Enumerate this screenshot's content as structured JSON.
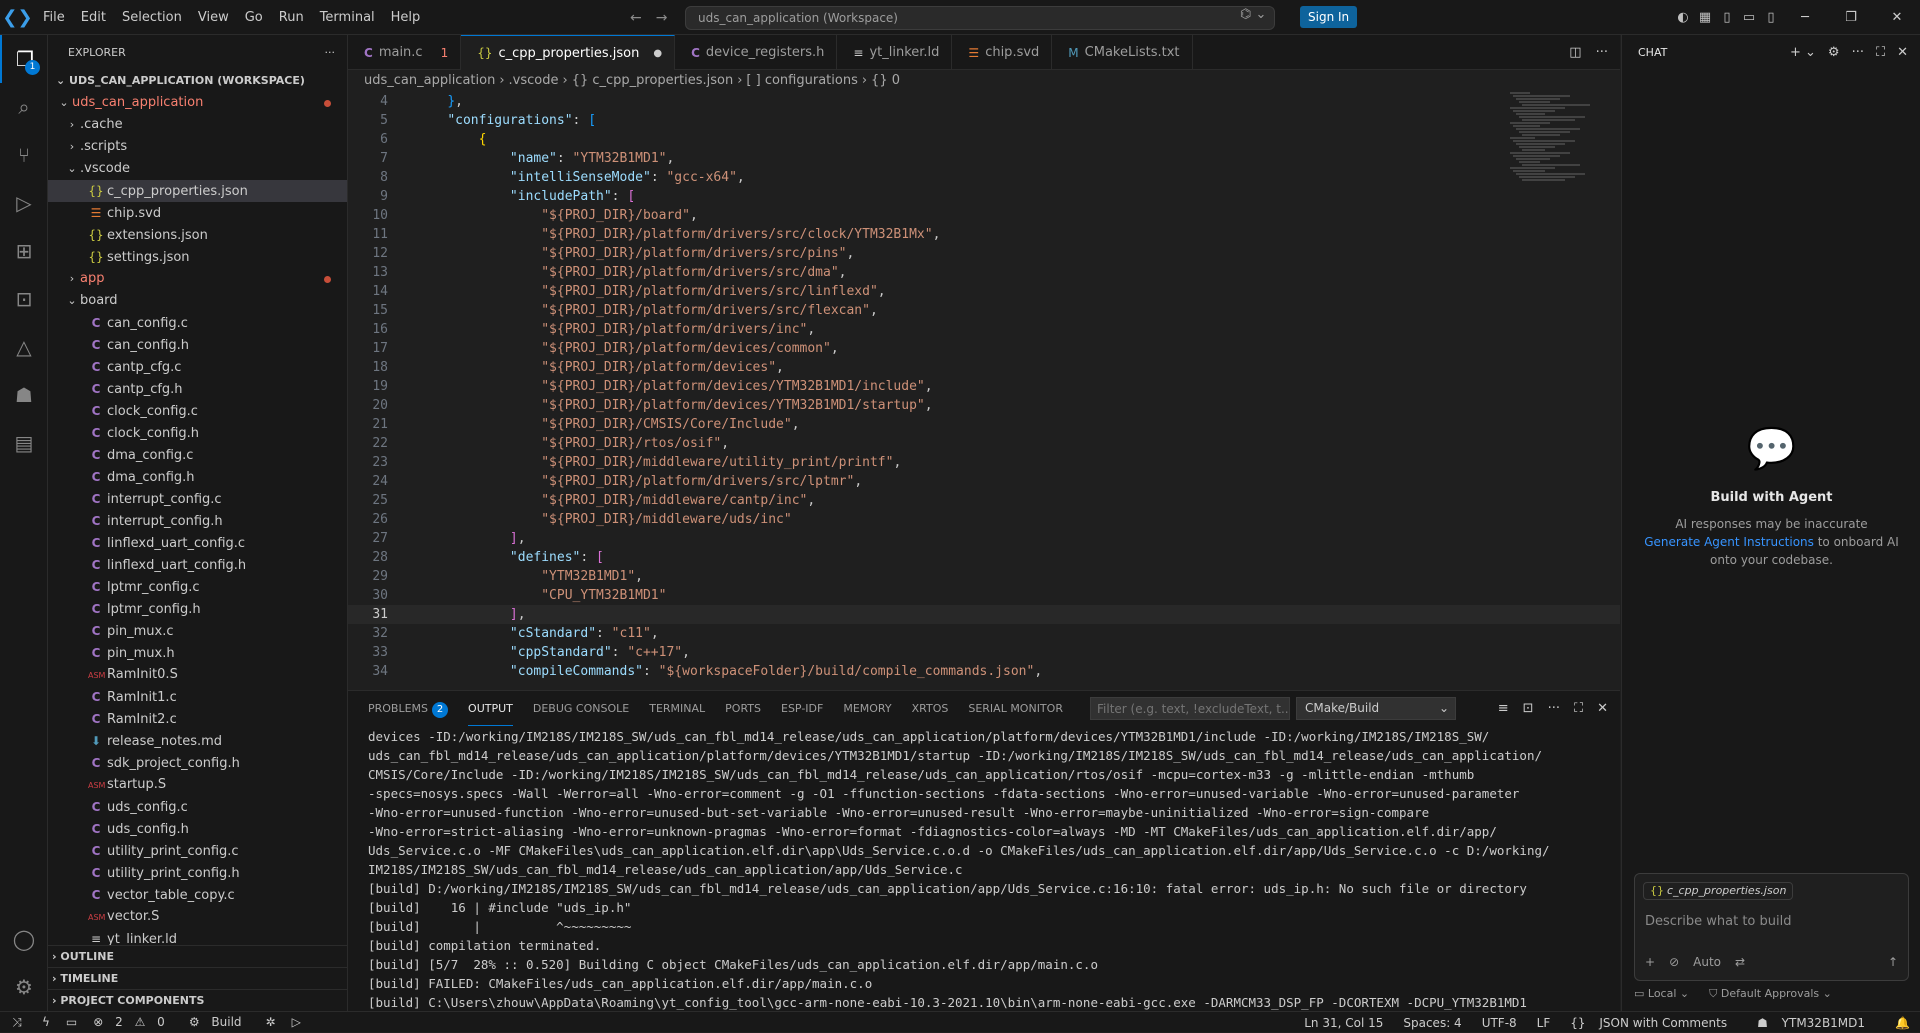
{
  "titlebar": {
    "menu": [
      "File",
      "Edit",
      "Selection",
      "View",
      "Go",
      "Run",
      "Terminal",
      "Help"
    ],
    "command_center": "uds_can_application (Workspace)",
    "signin_label": "Sign In"
  },
  "explorer": {
    "header": "EXPLORER",
    "workspace_title": "UDS_CAN_APPLICATION (WORKSPACE)",
    "items": [
      {
        "label": "uds_can_application",
        "indent": 0,
        "chev": "v",
        "icon": "",
        "cls": "red",
        "dot": true
      },
      {
        "label": ".cache",
        "indent": 1,
        "chev": ">",
        "icon": "",
        "cls": "",
        "dot": false
      },
      {
        "label": ".scripts",
        "indent": 1,
        "chev": ">",
        "icon": "",
        "cls": "",
        "dot": false
      },
      {
        "label": ".vscode",
        "indent": 1,
        "chev": "v",
        "icon": "",
        "cls": "",
        "dot": false
      },
      {
        "label": "c_cpp_properties.json",
        "indent": 2,
        "chev": "",
        "icon": "json",
        "cls": "",
        "dot": false,
        "selected": true
      },
      {
        "label": "chip.svd",
        "indent": 2,
        "chev": "",
        "icon": "svd",
        "cls": "",
        "dot": false
      },
      {
        "label": "extensions.json",
        "indent": 2,
        "chev": "",
        "icon": "json",
        "cls": "",
        "dot": false
      },
      {
        "label": "settings.json",
        "indent": 2,
        "chev": "",
        "icon": "json",
        "cls": "",
        "dot": false
      },
      {
        "label": "app",
        "indent": 1,
        "chev": ">",
        "icon": "",
        "cls": "red",
        "dot": true
      },
      {
        "label": "board",
        "indent": 1,
        "chev": "v",
        "icon": "",
        "cls": "",
        "dot": false
      },
      {
        "label": "can_config.c",
        "indent": 2,
        "chev": "",
        "icon": "c",
        "cls": "",
        "dot": false
      },
      {
        "label": "can_config.h",
        "indent": 2,
        "chev": "",
        "icon": "h",
        "cls": "",
        "dot": false
      },
      {
        "label": "cantp_cfg.c",
        "indent": 2,
        "chev": "",
        "icon": "c",
        "cls": "",
        "dot": false
      },
      {
        "label": "cantp_cfg.h",
        "indent": 2,
        "chev": "",
        "icon": "h",
        "cls": "",
        "dot": false
      },
      {
        "label": "clock_config.c",
        "indent": 2,
        "chev": "",
        "icon": "c",
        "cls": "",
        "dot": false
      },
      {
        "label": "clock_config.h",
        "indent": 2,
        "chev": "",
        "icon": "h",
        "cls": "",
        "dot": false
      },
      {
        "label": "dma_config.c",
        "indent": 2,
        "chev": "",
        "icon": "c",
        "cls": "",
        "dot": false
      },
      {
        "label": "dma_config.h",
        "indent": 2,
        "chev": "",
        "icon": "h",
        "cls": "",
        "dot": false
      },
      {
        "label": "interrupt_config.c",
        "indent": 2,
        "chev": "",
        "icon": "c",
        "cls": "",
        "dot": false
      },
      {
        "label": "interrupt_config.h",
        "indent": 2,
        "chev": "",
        "icon": "h",
        "cls": "",
        "dot": false
      },
      {
        "label": "linflexd_uart_config.c",
        "indent": 2,
        "chev": "",
        "icon": "c",
        "cls": "",
        "dot": false
      },
      {
        "label": "linflexd_uart_config.h",
        "indent": 2,
        "chev": "",
        "icon": "h",
        "cls": "",
        "dot": false
      },
      {
        "label": "lptmr_config.c",
        "indent": 2,
        "chev": "",
        "icon": "c",
        "cls": "",
        "dot": false
      },
      {
        "label": "lptmr_config.h",
        "indent": 2,
        "chev": "",
        "icon": "h",
        "cls": "",
        "dot": false
      },
      {
        "label": "pin_mux.c",
        "indent": 2,
        "chev": "",
        "icon": "c",
        "cls": "",
        "dot": false
      },
      {
        "label": "pin_mux.h",
        "indent": 2,
        "chev": "",
        "icon": "h",
        "cls": "",
        "dot": false
      },
      {
        "label": "RamInit0.S",
        "indent": 2,
        "chev": "",
        "icon": "asm",
        "cls": "",
        "dot": false
      },
      {
        "label": "RamInit1.c",
        "indent": 2,
        "chev": "",
        "icon": "c",
        "cls": "",
        "dot": false
      },
      {
        "label": "RamInit2.c",
        "indent": 2,
        "chev": "",
        "icon": "c",
        "cls": "",
        "dot": false
      },
      {
        "label": "release_notes.md",
        "indent": 2,
        "chev": "",
        "icon": "md",
        "cls": "",
        "dot": false
      },
      {
        "label": "sdk_project_config.h",
        "indent": 2,
        "chev": "",
        "icon": "h",
        "cls": "",
        "dot": false
      },
      {
        "label": "startup.S",
        "indent": 2,
        "chev": "",
        "icon": "asm",
        "cls": "",
        "dot": false
      },
      {
        "label": "uds_config.c",
        "indent": 2,
        "chev": "",
        "icon": "c",
        "cls": "",
        "dot": false
      },
      {
        "label": "uds_config.h",
        "indent": 2,
        "chev": "",
        "icon": "h",
        "cls": "",
        "dot": false
      },
      {
        "label": "utility_print_config.c",
        "indent": 2,
        "chev": "",
        "icon": "c",
        "cls": "",
        "dot": false
      },
      {
        "label": "utility_print_config.h",
        "indent": 2,
        "chev": "",
        "icon": "h",
        "cls": "",
        "dot": false
      },
      {
        "label": "vector_table_copy.c",
        "indent": 2,
        "chev": "",
        "icon": "c",
        "cls": "",
        "dot": false
      },
      {
        "label": "vector.S",
        "indent": 2,
        "chev": "",
        "icon": "asm",
        "cls": "",
        "dot": false
      },
      {
        "label": "yt_linker.ld",
        "indent": 2,
        "chev": "",
        "icon": "ld",
        "cls": "",
        "dot": false
      }
    ],
    "sections": [
      "OUTLINE",
      "TIMELINE",
      "PROJECT COMPONENTS"
    ]
  },
  "tabs": [
    {
      "label": "main.c",
      "icon": "c",
      "extra": "1",
      "active": false
    },
    {
      "label": "c_cpp_properties.json",
      "icon": "json",
      "extra": "dot",
      "active": true
    },
    {
      "label": "device_registers.h",
      "icon": "h",
      "extra": "",
      "active": false
    },
    {
      "label": "yt_linker.ld",
      "icon": "ld",
      "extra": "",
      "active": false
    },
    {
      "label": "chip.svd",
      "icon": "svd",
      "extra": "",
      "active": false
    },
    {
      "label": "CMakeLists.txt",
      "icon": "cmake",
      "extra": "",
      "active": false
    }
  ],
  "breadcrumb": [
    "uds_can_application",
    ".vscode",
    "{} c_cpp_properties.json",
    "[ ] configurations",
    "{} 0"
  ],
  "code": {
    "current_line": 31,
    "lines": [
      {
        "n": 4,
        "t": [
          [
            "p",
            "    "
          ],
          [
            "b2",
            "}"
          ],
          [
            "p",
            ","
          ]
        ]
      },
      {
        "n": 5,
        "t": [
          [
            "p",
            "    "
          ],
          [
            "k",
            "\"configurations\""
          ],
          [
            "p",
            ": "
          ],
          [
            "b2",
            "["
          ]
        ]
      },
      {
        "n": 6,
        "t": [
          [
            "p",
            "        "
          ],
          [
            "b3",
            "{"
          ]
        ]
      },
      {
        "n": 7,
        "t": [
          [
            "p",
            "            "
          ],
          [
            "k",
            "\"name\""
          ],
          [
            "p",
            ": "
          ],
          [
            "s",
            "\"YTM32B1MD1\""
          ],
          [
            "p",
            ","
          ]
        ]
      },
      {
        "n": 8,
        "t": [
          [
            "p",
            "            "
          ],
          [
            "k",
            "\"intelliSenseMode\""
          ],
          [
            "p",
            ": "
          ],
          [
            "s",
            "\"gcc-x64\""
          ],
          [
            "p",
            ","
          ]
        ]
      },
      {
        "n": 9,
        "t": [
          [
            "p",
            "            "
          ],
          [
            "k",
            "\"includePath\""
          ],
          [
            "p",
            ": "
          ],
          [
            "b1",
            "["
          ]
        ]
      },
      {
        "n": 10,
        "t": [
          [
            "p",
            "                "
          ],
          [
            "s",
            "\"${PROJ_DIR}/board\""
          ],
          [
            "p",
            ","
          ]
        ]
      },
      {
        "n": 11,
        "t": [
          [
            "p",
            "                "
          ],
          [
            "s",
            "\"${PROJ_DIR}/platform/drivers/src/clock/YTM32B1Mx\""
          ],
          [
            "p",
            ","
          ]
        ]
      },
      {
        "n": 12,
        "t": [
          [
            "p",
            "                "
          ],
          [
            "s",
            "\"${PROJ_DIR}/platform/drivers/src/pins\""
          ],
          [
            "p",
            ","
          ]
        ]
      },
      {
        "n": 13,
        "t": [
          [
            "p",
            "                "
          ],
          [
            "s",
            "\"${PROJ_DIR}/platform/drivers/src/dma\""
          ],
          [
            "p",
            ","
          ]
        ]
      },
      {
        "n": 14,
        "t": [
          [
            "p",
            "                "
          ],
          [
            "s",
            "\"${PROJ_DIR}/platform/drivers/src/linflexd\""
          ],
          [
            "p",
            ","
          ]
        ]
      },
      {
        "n": 15,
        "t": [
          [
            "p",
            "                "
          ],
          [
            "s",
            "\"${PROJ_DIR}/platform/drivers/src/flexcan\""
          ],
          [
            "p",
            ","
          ]
        ]
      },
      {
        "n": 16,
        "t": [
          [
            "p",
            "                "
          ],
          [
            "s",
            "\"${PROJ_DIR}/platform/drivers/inc\""
          ],
          [
            "p",
            ","
          ]
        ]
      },
      {
        "n": 17,
        "t": [
          [
            "p",
            "                "
          ],
          [
            "s",
            "\"${PROJ_DIR}/platform/devices/common\""
          ],
          [
            "p",
            ","
          ]
        ]
      },
      {
        "n": 18,
        "t": [
          [
            "p",
            "                "
          ],
          [
            "s",
            "\"${PROJ_DIR}/platform/devices\""
          ],
          [
            "p",
            ","
          ]
        ]
      },
      {
        "n": 19,
        "t": [
          [
            "p",
            "                "
          ],
          [
            "s",
            "\"${PROJ_DIR}/platform/devices/YTM32B1MD1/include\""
          ],
          [
            "p",
            ","
          ]
        ]
      },
      {
        "n": 20,
        "t": [
          [
            "p",
            "                "
          ],
          [
            "s",
            "\"${PROJ_DIR}/platform/devices/YTM32B1MD1/startup\""
          ],
          [
            "p",
            ","
          ]
        ]
      },
      {
        "n": 21,
        "t": [
          [
            "p",
            "                "
          ],
          [
            "s",
            "\"${PROJ_DIR}/CMSIS/Core/Include\""
          ],
          [
            "p",
            ","
          ]
        ]
      },
      {
        "n": 22,
        "t": [
          [
            "p",
            "                "
          ],
          [
            "s",
            "\"${PROJ_DIR}/rtos/osif\""
          ],
          [
            "p",
            ","
          ]
        ]
      },
      {
        "n": 23,
        "t": [
          [
            "p",
            "                "
          ],
          [
            "s",
            "\"${PROJ_DIR}/middleware/utility_print/printf\""
          ],
          [
            "p",
            ","
          ]
        ]
      },
      {
        "n": 24,
        "t": [
          [
            "p",
            "                "
          ],
          [
            "s",
            "\"${PROJ_DIR}/platform/drivers/src/lptmr\""
          ],
          [
            "p",
            ","
          ]
        ]
      },
      {
        "n": 25,
        "t": [
          [
            "p",
            "                "
          ],
          [
            "s",
            "\"${PROJ_DIR}/middleware/cantp/inc\""
          ],
          [
            "p",
            ","
          ]
        ]
      },
      {
        "n": 26,
        "t": [
          [
            "p",
            "                "
          ],
          [
            "s",
            "\"${PROJ_DIR}/middleware/uds/inc\""
          ]
        ]
      },
      {
        "n": 27,
        "t": [
          [
            "p",
            "            "
          ],
          [
            "b1",
            "]"
          ],
          [
            "p",
            ","
          ]
        ]
      },
      {
        "n": 28,
        "t": [
          [
            "p",
            "            "
          ],
          [
            "k",
            "\"defines\""
          ],
          [
            "p",
            ": "
          ],
          [
            "b1",
            "["
          ]
        ]
      },
      {
        "n": 29,
        "t": [
          [
            "p",
            "                "
          ],
          [
            "s",
            "\"YTM32B1MD1\""
          ],
          [
            "p",
            ","
          ]
        ]
      },
      {
        "n": 30,
        "t": [
          [
            "p",
            "                "
          ],
          [
            "s",
            "\"CPU_YTM32B1MD1\""
          ]
        ]
      },
      {
        "n": 31,
        "t": [
          [
            "p",
            "            "
          ],
          [
            "b1",
            "]"
          ],
          [
            "p",
            ","
          ]
        ]
      },
      {
        "n": 32,
        "t": [
          [
            "p",
            "            "
          ],
          [
            "k",
            "\"cStandard\""
          ],
          [
            "p",
            ": "
          ],
          [
            "s",
            "\"c11\""
          ],
          [
            "p",
            ","
          ]
        ]
      },
      {
        "n": 33,
        "t": [
          [
            "p",
            "            "
          ],
          [
            "k",
            "\"cppStandard\""
          ],
          [
            "p",
            ": "
          ],
          [
            "s",
            "\"c++17\""
          ],
          [
            "p",
            ","
          ]
        ]
      },
      {
        "n": 34,
        "t": [
          [
            "p",
            "            "
          ],
          [
            "k",
            "\"compileCommands\""
          ],
          [
            "p",
            ": "
          ],
          [
            "s",
            "\"${workspaceFolder}/build/compile_commands.json\""
          ],
          [
            "p",
            ","
          ]
        ]
      }
    ]
  },
  "panel": {
    "tabs": [
      {
        "label": "PROBLEMS",
        "badge": "2",
        "active": false
      },
      {
        "label": "OUTPUT",
        "badge": "",
        "active": true
      },
      {
        "label": "DEBUG CONSOLE",
        "badge": "",
        "active": false
      },
      {
        "label": "TERMINAL",
        "badge": "",
        "active": false
      },
      {
        "label": "PORTS",
        "badge": "",
        "active": false
      },
      {
        "label": "ESP-IDF",
        "badge": "",
        "active": false
      },
      {
        "label": "MEMORY",
        "badge": "",
        "active": false
      },
      {
        "label": "XRTOS",
        "badge": "",
        "active": false
      },
      {
        "label": "SERIAL MONITOR",
        "badge": "",
        "active": false
      }
    ],
    "filter_placeholder": "Filter (e.g. text, !excludeText, t...",
    "output_channel": "CMake/Build",
    "lines": [
      "devices -ID:/working/IM218S/IM218S_SW/uds_can_fbl_md14_release/uds_can_application/platform/devices/YTM32B1MD1/include -ID:/working/IM218S/IM218S_SW/",
      "uds_can_fbl_md14_release/uds_can_application/platform/devices/YTM32B1MD1/startup -ID:/working/IM218S/IM218S_SW/uds_can_fbl_md14_release/uds_can_application/",
      "CMSIS/Core/Include -ID:/working/IM218S/IM218S_SW/uds_can_fbl_md14_release/uds_can_application/rtos/osif -mcpu=cortex-m33 -g -mlittle-endian -mthumb",
      "-specs=nosys.specs -Wall -Werror=all -Wno-error=comment -g -O1 -ffunction-sections -fdata-sections -Wno-error=unused-variable -Wno-error=unused-parameter",
      "-Wno-error=unused-function -Wno-error=unused-but-set-variable -Wno-error=unused-result -Wno-error=maybe-uninitialized -Wno-error=sign-compare",
      "-Wno-error=strict-aliasing -Wno-error=unknown-pragmas -Wno-error=format -fdiagnostics-color=always -MD -MT CMakeFiles/uds_can_application.elf.dir/app/",
      "Uds_Service.c.o -MF CMakeFiles\\uds_can_application.elf.dir\\app\\Uds_Service.c.o.d -o CMakeFiles/uds_can_application.elf.dir/app/Uds_Service.c.o -c D:/working/",
      "IM218S/IM218S_SW/uds_can_fbl_md14_release/uds_can_application/app/Uds_Service.c",
      "[build] D:/working/IM218S/IM218S_SW/uds_can_fbl_md14_release/uds_can_application/app/Uds_Service.c:16:10: fatal error: uds_ip.h: No such file or directory",
      "[build]    16 | #include \"uds_ip.h\"",
      "[build]       |          ^~~~~~~~~~",
      "[build] compilation terminated.",
      "[build] [5/7  28% :: 0.520] Building C object CMakeFiles/uds_can_application.elf.dir/app/main.c.o",
      "[build] FAILED: CMakeFiles/uds_can_application.elf.dir/app/main.c.o",
      "[build] C:\\Users\\zhouw\\AppData\\Roaming\\yt_config_tool\\gcc-arm-none-eabi-10.3-2021.10\\bin\\arm-none-eabi-gcc.exe -DARMCM33_DSP_FP -DCORTEXM -DCPU_YTM32B1MD1"
    ]
  },
  "chat": {
    "header": "CHAT",
    "empty_title": "Build with Agent",
    "empty_line1": "AI responses may be inaccurate",
    "empty_link": "Generate Agent Instructions",
    "empty_line2": " to onboard AI onto your codebase.",
    "context_chip": "c_cpp_properties.json",
    "input_placeholder": "Describe what to build",
    "mode": "Auto",
    "footer_local": "Local",
    "footer_approvals": "Default Approvals"
  },
  "statusbar": {
    "errors": "2",
    "warnings": "0",
    "build_label": "Build",
    "position": "Ln 31, Col 15",
    "spaces": "Spaces: 4",
    "encoding": "UTF-8",
    "eol": "LF",
    "language": "JSON with Comments",
    "config": "YTM32B1MD1"
  }
}
